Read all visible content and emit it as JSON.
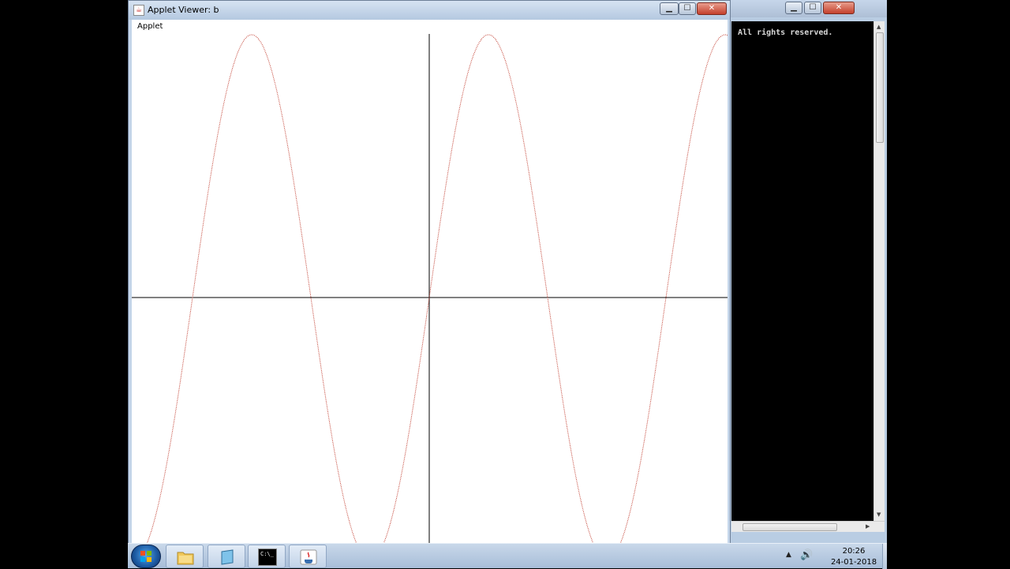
{
  "applet_window": {
    "title": "Applet Viewer: b",
    "applet_label": "Applet",
    "controls": {
      "minimize": "▁",
      "maximize": "☐",
      "close": "✕"
    }
  },
  "console_window": {
    "text": "All rights reserved.",
    "controls": {
      "minimize": "▁",
      "maximize": "☐",
      "close": "✕"
    }
  },
  "plot": {
    "curve_color": "#c0392b",
    "axis_color": "#000000",
    "amplitude": 1,
    "periods_visible": 2.5
  },
  "taskbar": {
    "items": [
      {
        "name": "windows-explorer",
        "icon": "folder-icon"
      },
      {
        "name": "notepad",
        "icon": "notepad-icon"
      },
      {
        "name": "command-prompt",
        "icon": "cmd-icon",
        "label": "C:\\_"
      },
      {
        "name": "java",
        "icon": "java-icon"
      }
    ],
    "clock": {
      "time": "20:26",
      "date": "24-01-2018"
    }
  }
}
